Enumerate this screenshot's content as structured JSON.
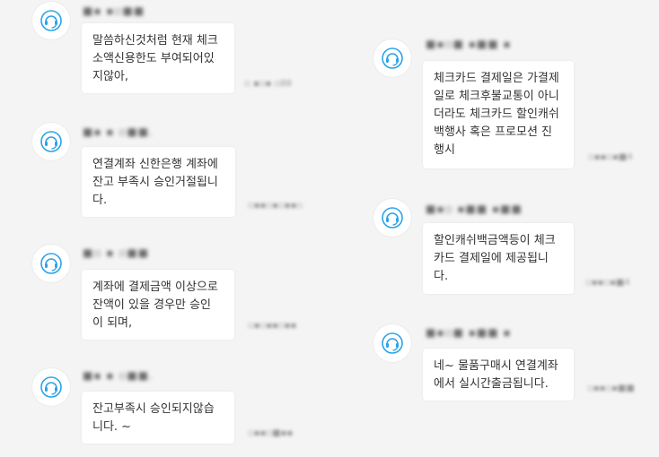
{
  "messages": [
    {
      "side": "left",
      "sender": "■▪ ▪▫■■",
      "text": "말씀하신것처럼 현재 체크\n소액신용한도 부여되어있\n지않아,",
      "time": "▫ ▪▫▪ ▫88",
      "icon": "headset-icon"
    },
    {
      "side": "left",
      "sender": "■▪ ▪ ▫■■.",
      "text": "연결계좌 신한은행 계좌에\n잔고 부족시 승인거절됩니\n다.",
      "time": "▫▪▪▫▪▫▪▪▫",
      "icon": "headset-icon"
    },
    {
      "side": "left",
      "sender": "■▫ ▪ ▫■■",
      "text": "계좌에 결제금액 이상으로\n잔액이 있을 경우만 승인\n이 되며,",
      "time": "▫▪▫▪▪▫▪▪",
      "icon": "headset-icon"
    },
    {
      "side": "left",
      "sender": "■▪ ▪ ▫■■.",
      "text": "잔고부족시 승인되지않습\n니다. ~",
      "time": "▫▪▪▫■▪▪",
      "icon": "headset-icon"
    },
    {
      "side": "right",
      "sender": "■▪▫■ ▪■■ ▪",
      "text": "체크카드 결제일은 가결제\n일로 체크후불교통이 아니\n더라도 체크카드 할인캐쉬\n백행사 혹은 프로모션 진\n행시",
      "time": "▫▪▪▫▪■4",
      "icon": "headset-icon"
    },
    {
      "side": "right",
      "sender": "■▪▫ ▪■■ ▪■■",
      "text": "할인캐쉬백금액등이 체크\n카드 결제일에 제공됩니\n다.",
      "time": "▫▪▪▫▪■4",
      "icon": "headset-icon"
    },
    {
      "side": "right",
      "sender": "■▪▫■ ▪■■ ▪",
      "text": "네~ 물품구매시 연결계좌\n에서 실시간출금됩니다.",
      "time": "▫▪▪▫▪■■",
      "icon": "headset-icon"
    }
  ]
}
